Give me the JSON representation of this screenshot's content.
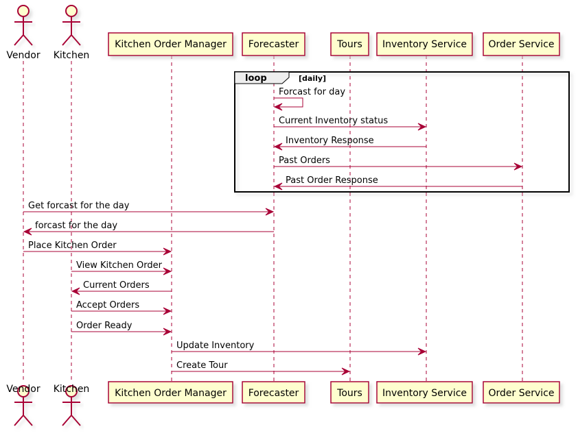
{
  "diagram": {
    "type": "sequence",
    "colors": {
      "participant_fill": "#FEFECE",
      "participant_border": "#A80036",
      "arrow": "#A80036",
      "text": "#000000",
      "loop_header_fill": "#EEEEEE",
      "shadow": "#C8C8C8"
    },
    "participants": [
      {
        "id": "vendor",
        "label": "Vendor",
        "kind": "actor"
      },
      {
        "id": "kitchen",
        "label": "Kitchen",
        "kind": "actor"
      },
      {
        "id": "kom",
        "label": "Kitchen Order Manager",
        "kind": "participant"
      },
      {
        "id": "forecaster",
        "label": "Forecaster",
        "kind": "participant"
      },
      {
        "id": "tours",
        "label": "Tours",
        "kind": "participant"
      },
      {
        "id": "inventory",
        "label": "Inventory Service",
        "kind": "participant"
      },
      {
        "id": "orders",
        "label": "Order Service",
        "kind": "participant"
      }
    ],
    "loop": {
      "keyword": "loop",
      "condition": "[daily]"
    },
    "messages": [
      {
        "from": "forecaster",
        "to": "forecaster",
        "label": "Forcast for day",
        "in_loop": true
      },
      {
        "from": "forecaster",
        "to": "inventory",
        "label": "Current Inventory status",
        "in_loop": true
      },
      {
        "from": "inventory",
        "to": "forecaster",
        "label": "Inventory Response",
        "in_loop": true
      },
      {
        "from": "forecaster",
        "to": "orders",
        "label": "Past Orders",
        "in_loop": true
      },
      {
        "from": "orders",
        "to": "forecaster",
        "label": "Past Order Response",
        "in_loop": true
      },
      {
        "from": "vendor",
        "to": "forecaster",
        "label": "Get forcast for the day"
      },
      {
        "from": "forecaster",
        "to": "vendor",
        "label": "forcast for the day"
      },
      {
        "from": "vendor",
        "to": "kom",
        "label": "Place Kitchen Order"
      },
      {
        "from": "kitchen",
        "to": "kom",
        "label": "View Kitchen Order"
      },
      {
        "from": "kom",
        "to": "kitchen",
        "label": "Current Orders"
      },
      {
        "from": "kitchen",
        "to": "kom",
        "label": "Accept Orders"
      },
      {
        "from": "kitchen",
        "to": "kom",
        "label": "Order Ready"
      },
      {
        "from": "kom",
        "to": "inventory",
        "label": "Update Inventory"
      },
      {
        "from": "kom",
        "to": "tours",
        "label": "Create Tour"
      }
    ]
  }
}
